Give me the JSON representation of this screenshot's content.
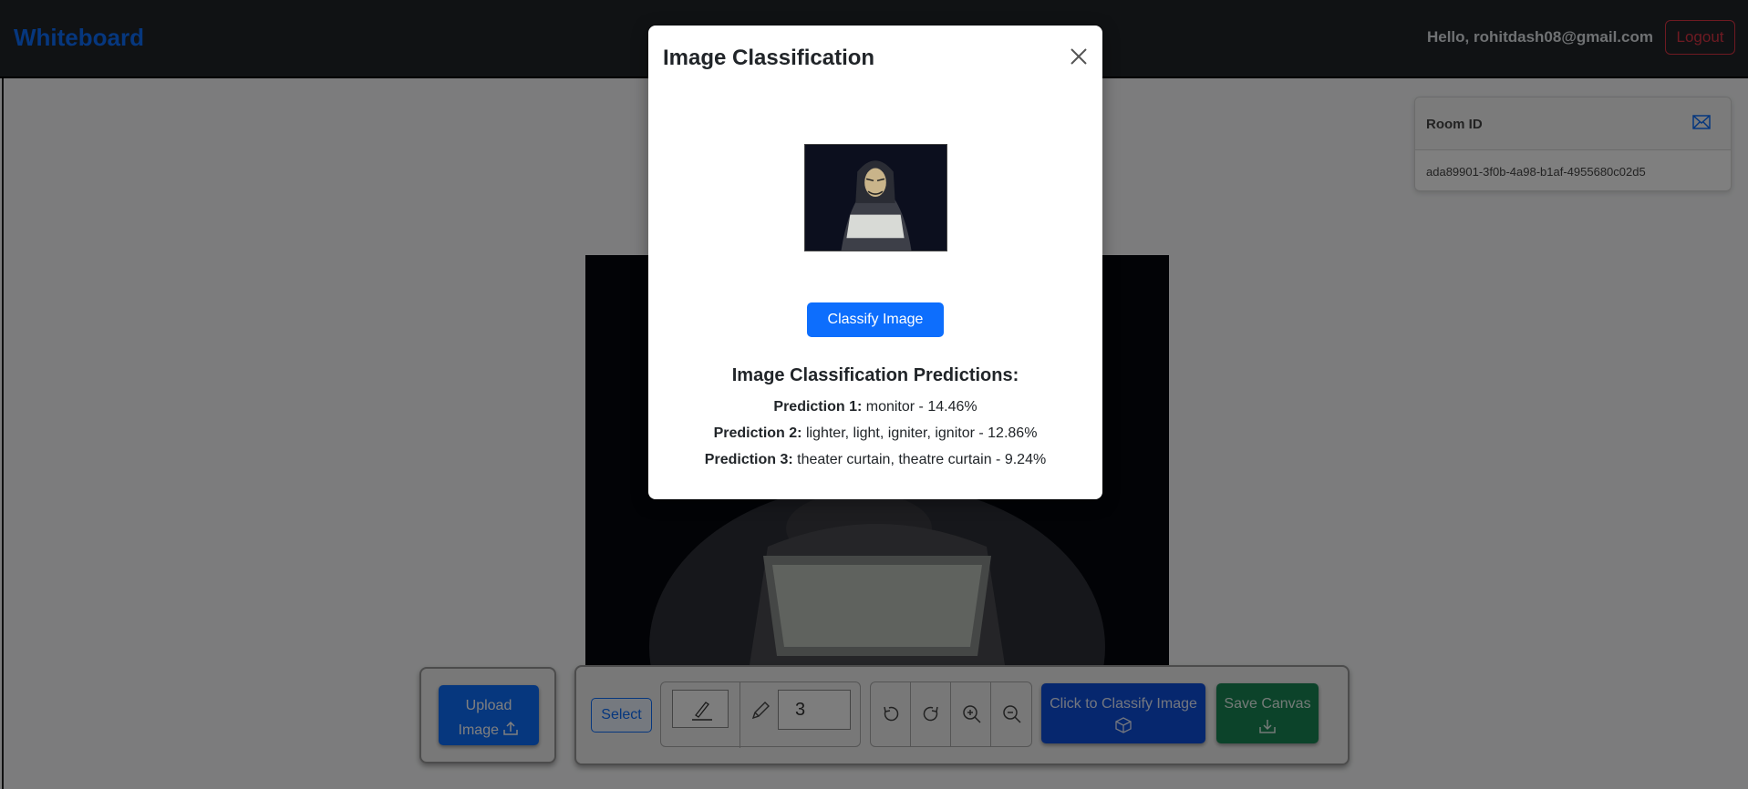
{
  "navbar": {
    "brand": "Whiteboard",
    "greeting": "Hello, rohitdash08@gmail.com",
    "logout_label": "Logout"
  },
  "room": {
    "title": "Room ID",
    "id": "ada89901-3f0b-4a98-b1af-4955680c02d5"
  },
  "toolbar": {
    "upload_label": "Upload",
    "upload_label2": "Image",
    "select_label": "Select",
    "stroke_width": "3",
    "classify_label": "Click to Classify Image",
    "save_label": "Save Canvas",
    "icons": [
      "pen-icon",
      "pencil-icon",
      "undo-icon",
      "redo-icon",
      "zoom-in-icon",
      "zoom-out-icon",
      "box-icon",
      "download-icon",
      "upload-icon"
    ]
  },
  "modal": {
    "title": "Image Classification",
    "classify_button": "Classify Image",
    "predictions_title": "Image Classification Predictions:",
    "predictions": [
      {
        "label": "Prediction 1:",
        "text": "monitor - 14.46%"
      },
      {
        "label": "Prediction 2:",
        "text": "lighter, light, igniter, ignitor - 12.86%"
      },
      {
        "label": "Prediction 3:",
        "text": "theater curtain, theatre curtain - 9.24%"
      }
    ]
  },
  "colors": {
    "primary": "#0d6efd",
    "danger": "#dc3545",
    "success": "#198754",
    "navbar": "#212529"
  }
}
